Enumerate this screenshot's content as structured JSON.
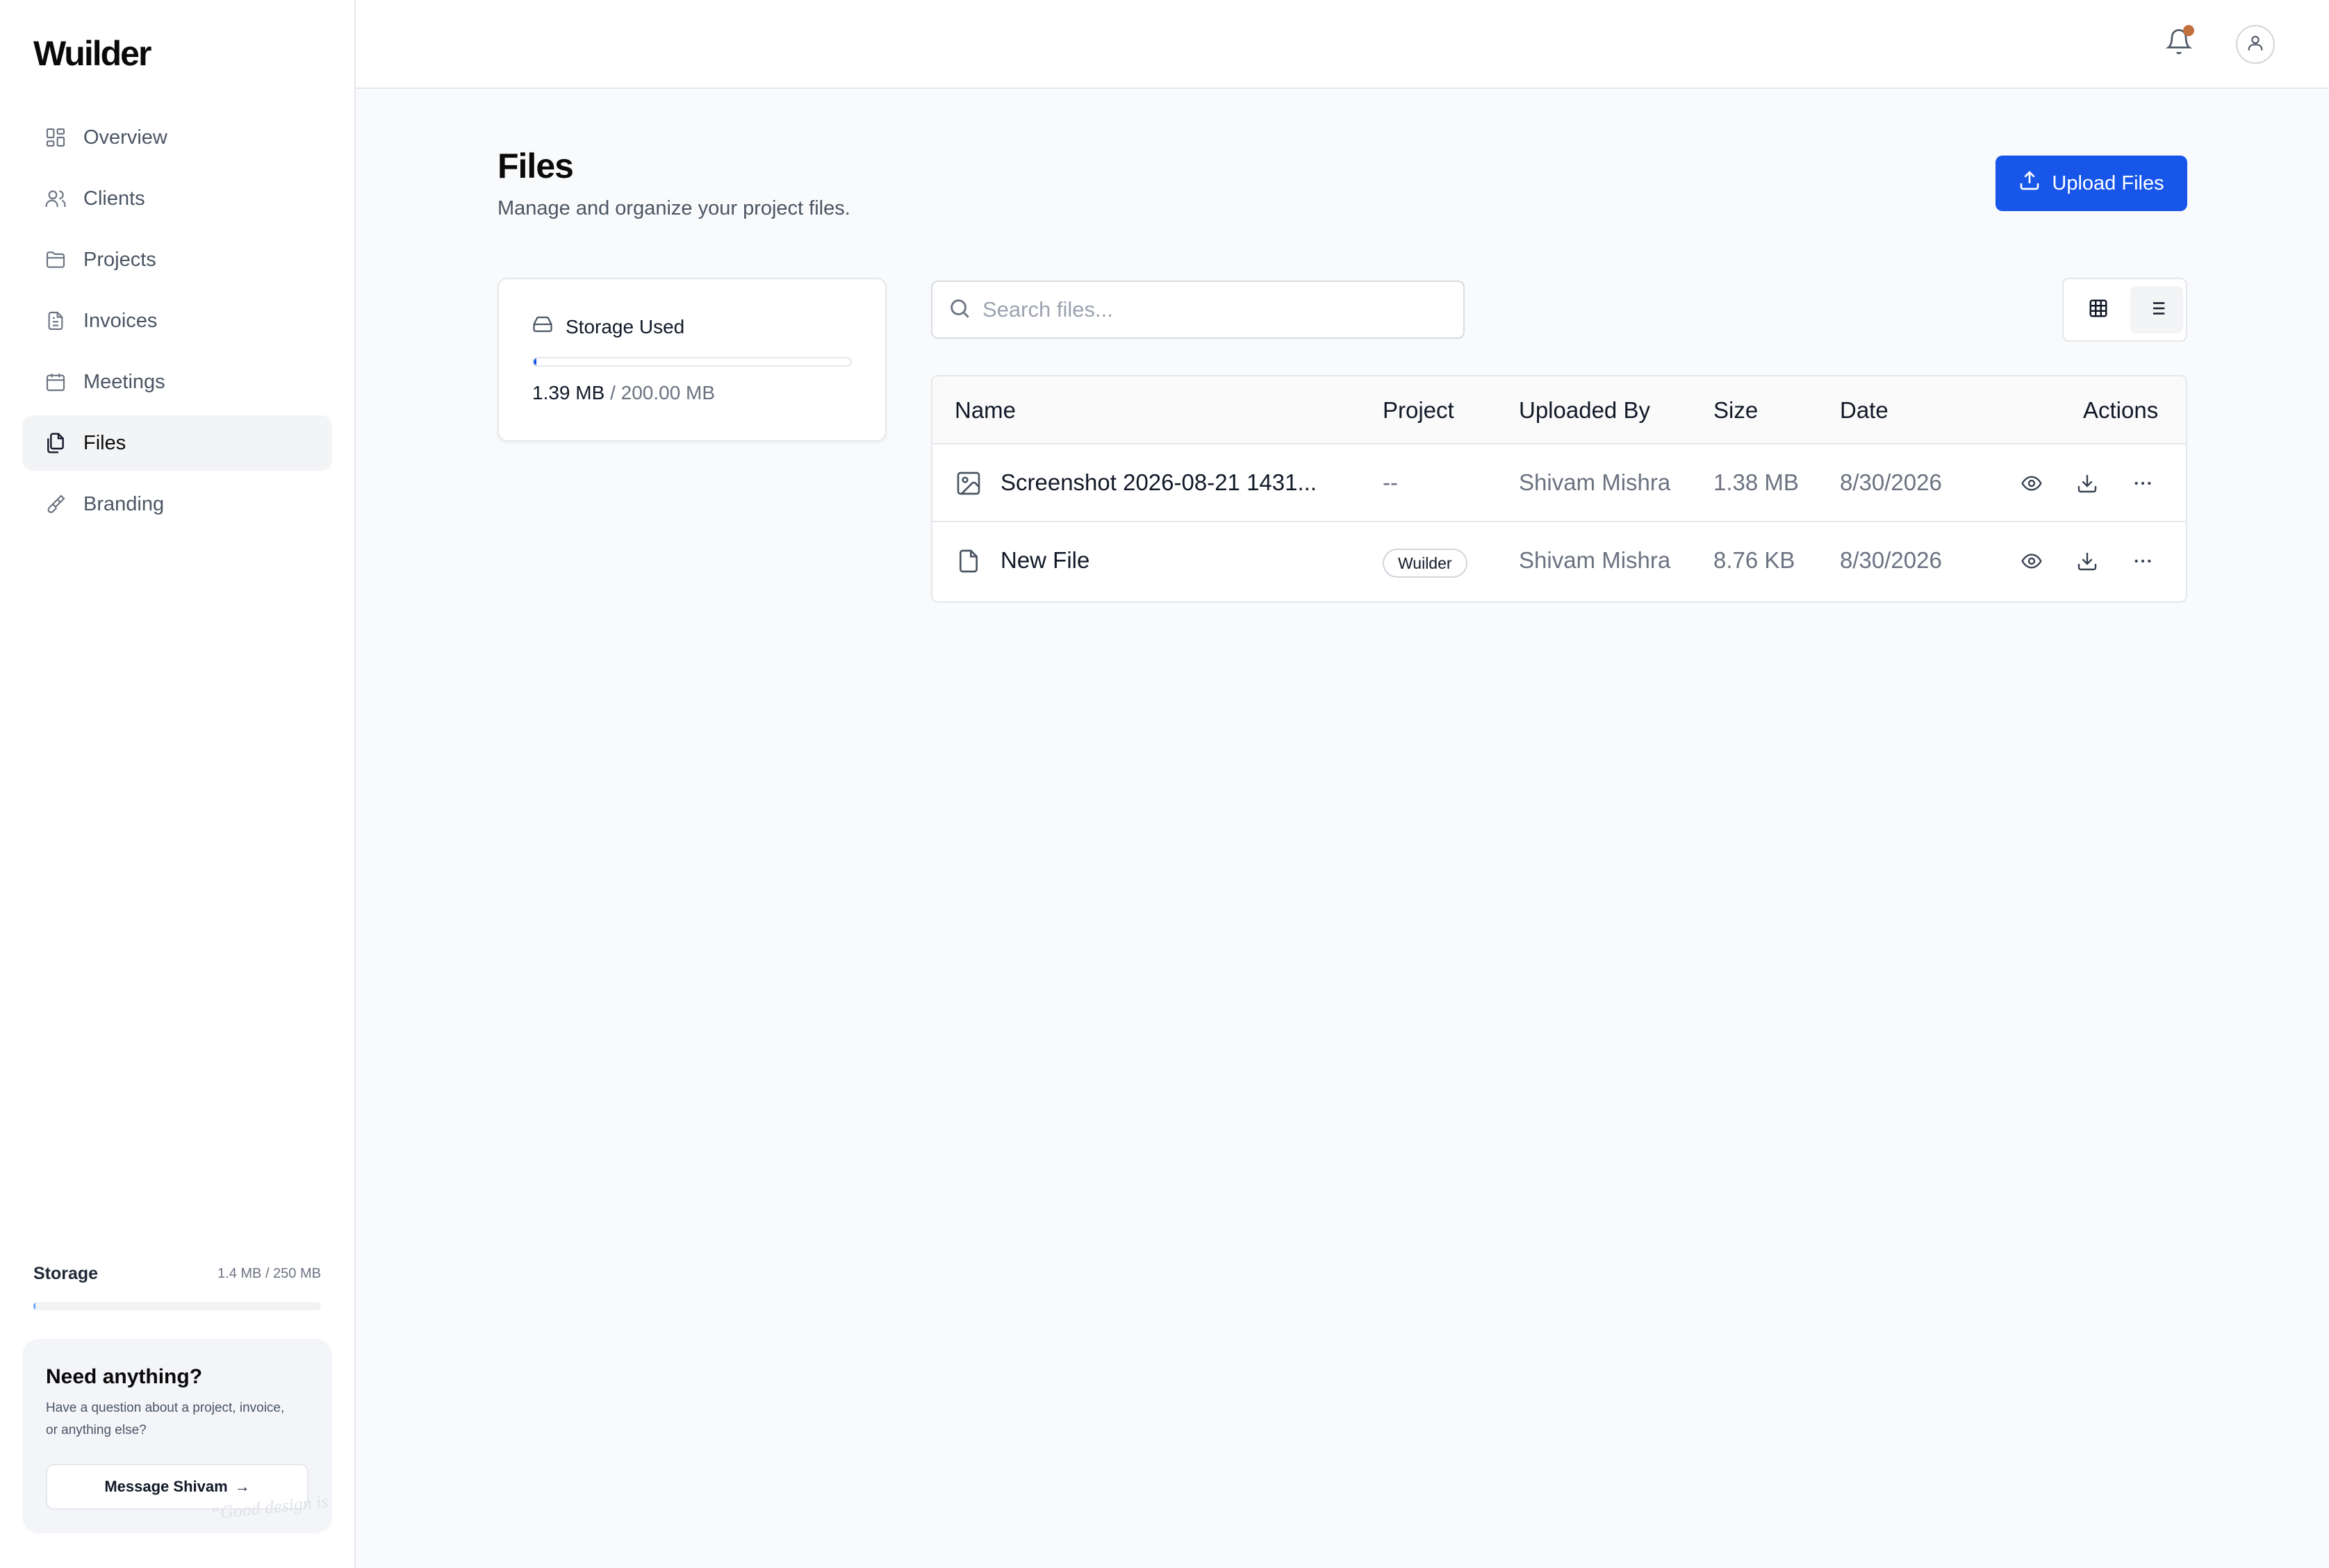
{
  "app": {
    "logo": "Wuilder"
  },
  "sidebar": {
    "items": [
      {
        "label": "Overview",
        "icon": "dashboard-icon"
      },
      {
        "label": "Clients",
        "icon": "users-icon"
      },
      {
        "label": "Projects",
        "icon": "folder-icon"
      },
      {
        "label": "Invoices",
        "icon": "document-icon"
      },
      {
        "label": "Meetings",
        "icon": "calendar-icon"
      },
      {
        "label": "Files",
        "icon": "files-icon",
        "active": true
      },
      {
        "label": "Branding",
        "icon": "brush-icon"
      }
    ],
    "storage": {
      "label": "Storage",
      "value": "1.4 MB / 250 MB",
      "fraction": 0.0056
    },
    "help": {
      "title": "Need anything?",
      "description": "Have a question about a project, invoice, or anything else?",
      "button_label": "Message Shivam",
      "watermark": "“Good design is invisible.”"
    }
  },
  "topbar": {
    "notifications_badge_color": "#c2703d"
  },
  "page": {
    "title": "Files",
    "subtitle": "Manage and organize your project files.",
    "upload_label": "Upload Files",
    "accent": "#1756e8"
  },
  "storage_card": {
    "title": "Storage Used",
    "used": "1.39 MB",
    "total": "/ 200.00 MB",
    "fraction": 0.007
  },
  "search": {
    "placeholder": "Search files...",
    "value": ""
  },
  "view": {
    "active": "list"
  },
  "table": {
    "columns": [
      "Name",
      "Project",
      "Uploaded By",
      "Size",
      "Date",
      "Actions"
    ],
    "rows": [
      {
        "icon": "image-file-icon",
        "name": "Screenshot 2026-08-21 1431...",
        "project": "--",
        "uploaded_by": "Shivam Mishra",
        "size": "1.38 MB",
        "date": "8/30/2026"
      },
      {
        "icon": "file-icon",
        "name": "New File",
        "project": "Wuilder",
        "uploaded_by": "Shivam Mishra",
        "size": "8.76 KB",
        "date": "8/30/2026"
      }
    ]
  }
}
